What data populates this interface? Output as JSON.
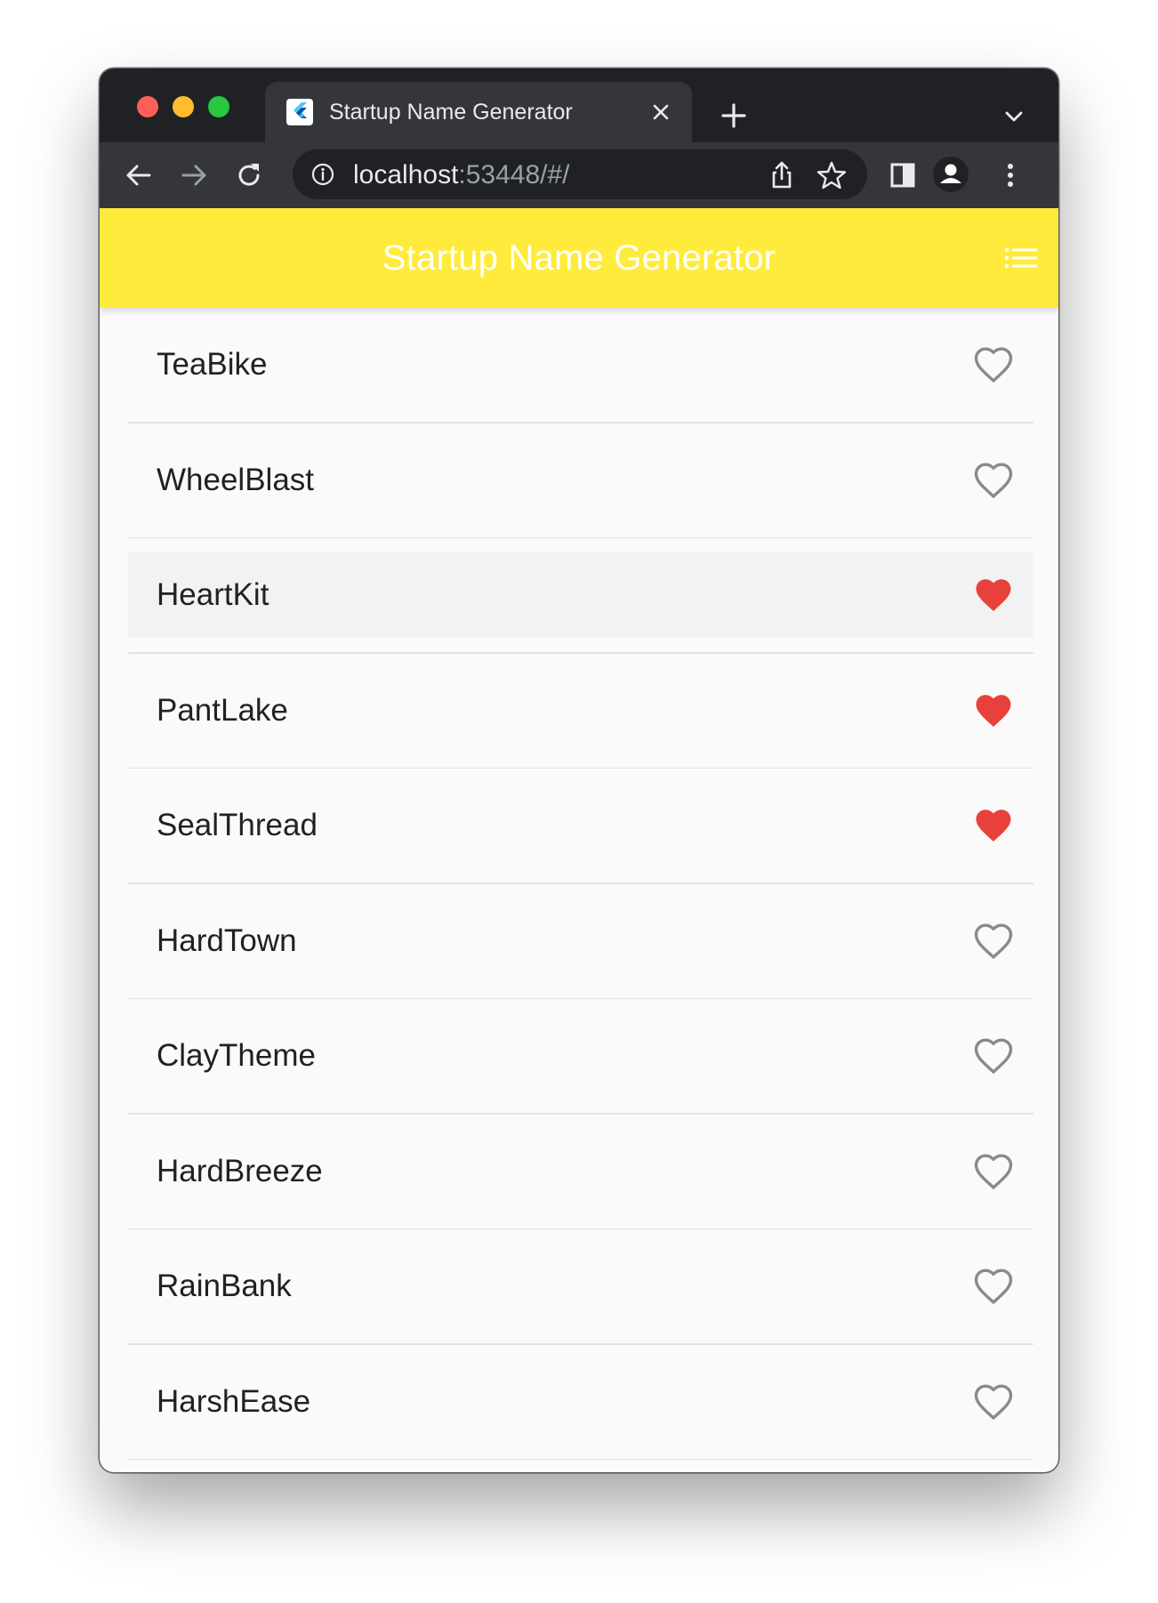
{
  "browser": {
    "tab_title": "Startup Name Generator",
    "url_host": "localhost",
    "url_rest": ":53448/#/"
  },
  "app": {
    "title": "Startup Name Generator",
    "accent_color": "#ffeb3b",
    "favorite_color": "#e8413c"
  },
  "list": {
    "items": [
      {
        "label": "TeaBike",
        "favorited": false
      },
      {
        "label": "WheelBlast",
        "favorited": false
      },
      {
        "label": "HeartKit",
        "favorited": true
      },
      {
        "label": "PantLake",
        "favorited": true
      },
      {
        "label": "SealThread",
        "favorited": true
      },
      {
        "label": "HardTown",
        "favorited": false
      },
      {
        "label": "ClayTheme",
        "favorited": false
      },
      {
        "label": "HardBreeze",
        "favorited": false
      },
      {
        "label": "RainBank",
        "favorited": false
      },
      {
        "label": "HarshEase",
        "favorited": false
      }
    ]
  }
}
